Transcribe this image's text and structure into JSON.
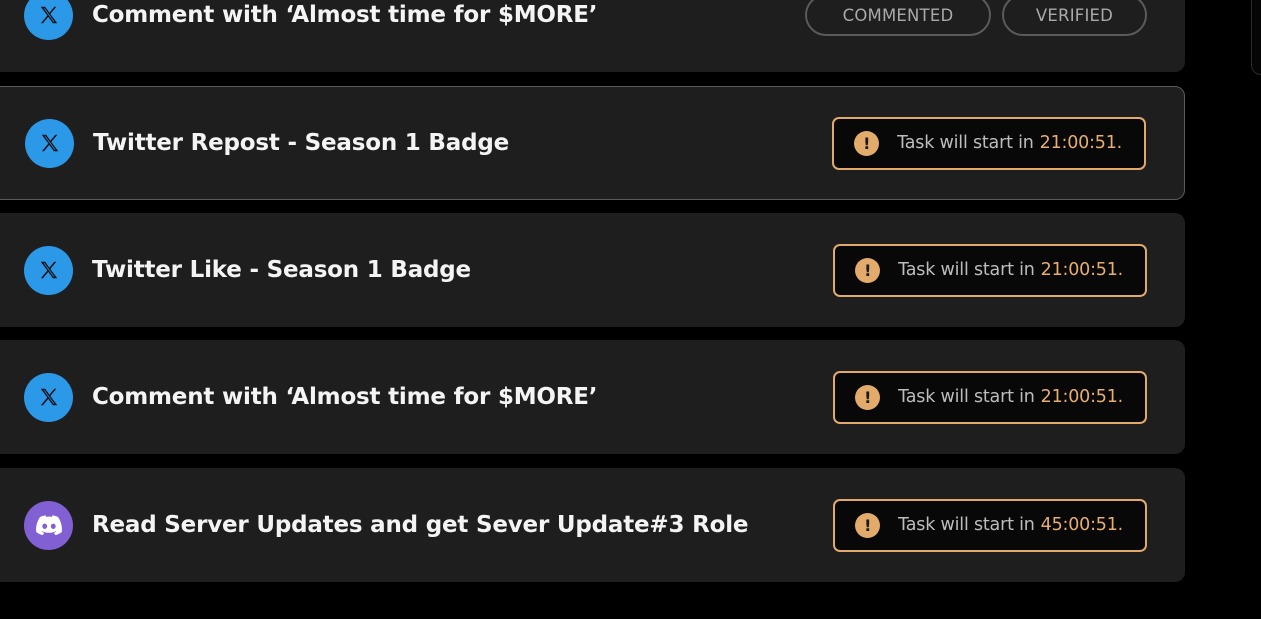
{
  "tasks": [
    {
      "icon": "x-icon",
      "title": "Comment with ‘Almost time for $MORE’",
      "status_labels": [
        "COMMENTED",
        "VERIFIED"
      ]
    },
    {
      "icon": "x-icon",
      "title": "Twitter Repost - Season 1 Badge",
      "timer_label": "Task will start in",
      "timer_value": "21:00:51."
    },
    {
      "icon": "x-icon",
      "title": "Twitter Like - Season 1 Badge",
      "timer_label": "Task will start in",
      "timer_value": "21:00:51."
    },
    {
      "icon": "x-icon",
      "title": "Comment with ‘Almost time for $MORE’",
      "timer_label": "Task will start in",
      "timer_value": "21:00:51."
    },
    {
      "icon": "discord-icon",
      "title": "Read Server Updates and get Sever Update#3 Role",
      "timer_label": "Task will start in",
      "timer_value": "45:00:51."
    }
  ],
  "colors": {
    "background": "#000000",
    "card": "#1e1e1f",
    "x_blue": "#2b98e8",
    "discord_purple": "#8160d4",
    "timer_accent": "#e1a96a",
    "status_border": "#5a5a5a"
  }
}
